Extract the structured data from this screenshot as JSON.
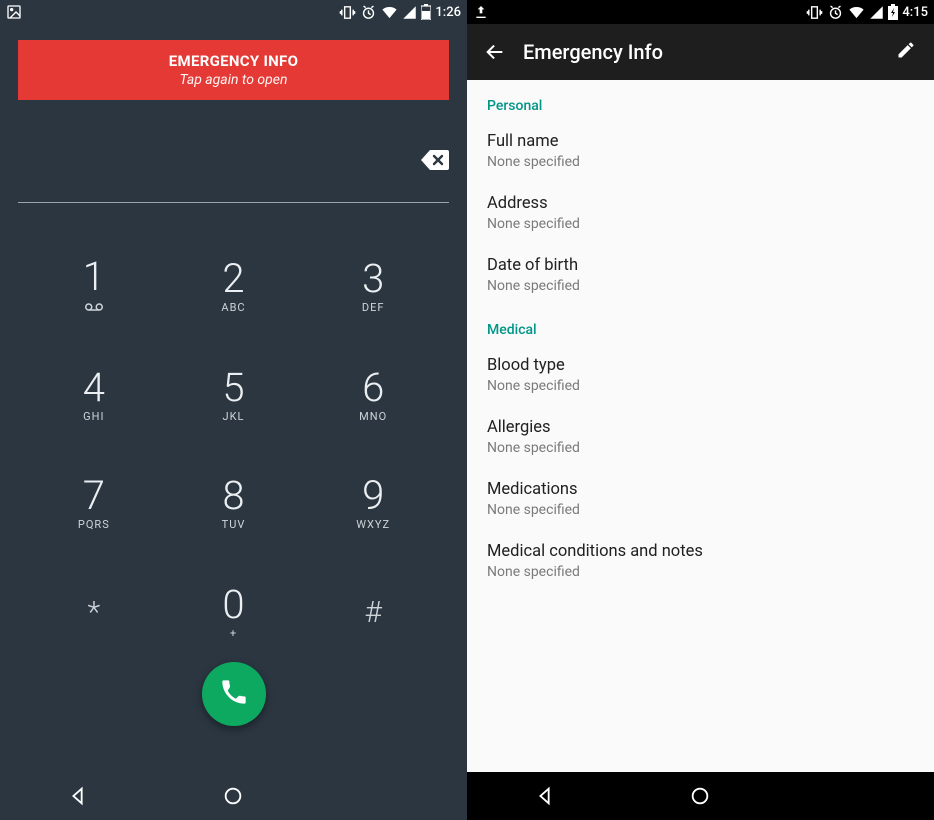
{
  "left": {
    "status": {
      "time": "1:26"
    },
    "banner": {
      "title": "EMERGENCY INFO",
      "subtitle": "Tap again to open"
    },
    "keys": [
      {
        "digit": "1",
        "letters": "",
        "voicemail": true
      },
      {
        "digit": "2",
        "letters": "ABC"
      },
      {
        "digit": "3",
        "letters": "DEF"
      },
      {
        "digit": "4",
        "letters": "GHI"
      },
      {
        "digit": "5",
        "letters": "JKL"
      },
      {
        "digit": "6",
        "letters": "MNO"
      },
      {
        "digit": "7",
        "letters": "PQRS"
      },
      {
        "digit": "8",
        "letters": "TUV"
      },
      {
        "digit": "9",
        "letters": "WXYZ"
      },
      {
        "symbol": "*"
      },
      {
        "digit": "0",
        "letters": "+"
      },
      {
        "symbol": "#"
      }
    ]
  },
  "right": {
    "status": {
      "time": "4:15"
    },
    "appbar": {
      "title": "Emergency Info"
    },
    "sections": [
      {
        "header": "Personal",
        "items": [
          {
            "label": "Full name",
            "value": "None specified"
          },
          {
            "label": "Address",
            "value": "None specified"
          },
          {
            "label": "Date of birth",
            "value": "None specified"
          }
        ]
      },
      {
        "header": "Medical",
        "items": [
          {
            "label": "Blood type",
            "value": "None specified"
          },
          {
            "label": "Allergies",
            "value": "None specified"
          },
          {
            "label": "Medications",
            "value": "None specified"
          },
          {
            "label": "Medical conditions and notes",
            "value": "None specified"
          }
        ]
      }
    ]
  }
}
